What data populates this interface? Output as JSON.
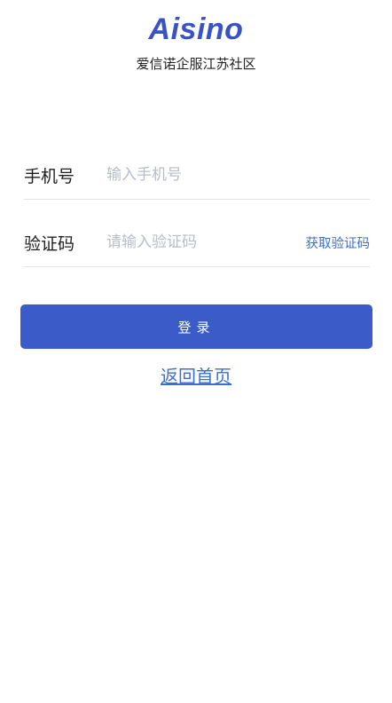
{
  "header": {
    "logo_text": "Aisino",
    "subtitle": "爱信诺企服江苏社区"
  },
  "form": {
    "phone": {
      "label": "手机号",
      "placeholder": "输入手机号",
      "value": ""
    },
    "code": {
      "label": "验证码",
      "placeholder": "请输入验证码",
      "value": "",
      "get_code_label": "获取验证码"
    }
  },
  "actions": {
    "login_label": "登录",
    "back_home_label": "返回首页"
  },
  "colors": {
    "brand": "#3a53c4",
    "primary_button": "#3b5cc8",
    "link": "#3a6fd0"
  }
}
